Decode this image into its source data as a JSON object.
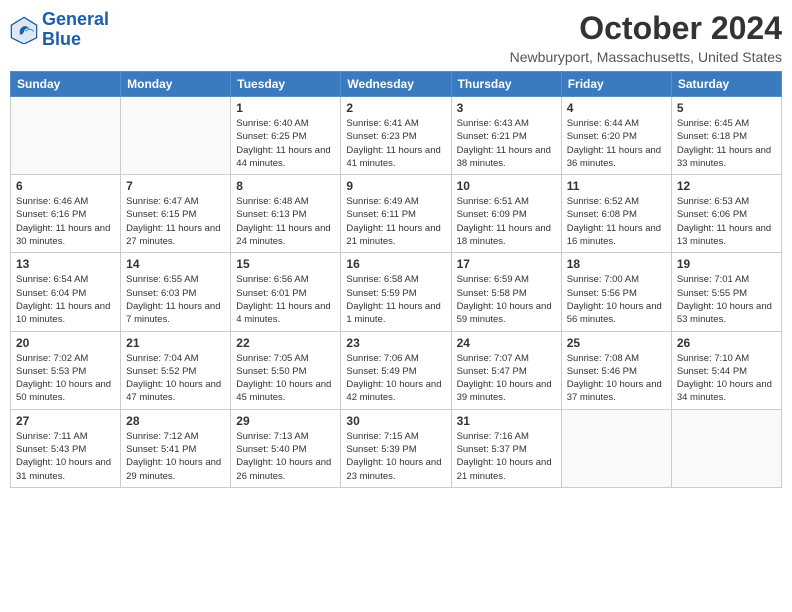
{
  "header": {
    "logo_line1": "General",
    "logo_line2": "Blue",
    "month": "October 2024",
    "location": "Newburyport, Massachusetts, United States"
  },
  "weekdays": [
    "Sunday",
    "Monday",
    "Tuesday",
    "Wednesday",
    "Thursday",
    "Friday",
    "Saturday"
  ],
  "weeks": [
    [
      {
        "day": "",
        "info": ""
      },
      {
        "day": "",
        "info": ""
      },
      {
        "day": "1",
        "info": "Sunrise: 6:40 AM\nSunset: 6:25 PM\nDaylight: 11 hours and 44 minutes."
      },
      {
        "day": "2",
        "info": "Sunrise: 6:41 AM\nSunset: 6:23 PM\nDaylight: 11 hours and 41 minutes."
      },
      {
        "day": "3",
        "info": "Sunrise: 6:43 AM\nSunset: 6:21 PM\nDaylight: 11 hours and 38 minutes."
      },
      {
        "day": "4",
        "info": "Sunrise: 6:44 AM\nSunset: 6:20 PM\nDaylight: 11 hours and 36 minutes."
      },
      {
        "day": "5",
        "info": "Sunrise: 6:45 AM\nSunset: 6:18 PM\nDaylight: 11 hours and 33 minutes."
      }
    ],
    [
      {
        "day": "6",
        "info": "Sunrise: 6:46 AM\nSunset: 6:16 PM\nDaylight: 11 hours and 30 minutes."
      },
      {
        "day": "7",
        "info": "Sunrise: 6:47 AM\nSunset: 6:15 PM\nDaylight: 11 hours and 27 minutes."
      },
      {
        "day": "8",
        "info": "Sunrise: 6:48 AM\nSunset: 6:13 PM\nDaylight: 11 hours and 24 minutes."
      },
      {
        "day": "9",
        "info": "Sunrise: 6:49 AM\nSunset: 6:11 PM\nDaylight: 11 hours and 21 minutes."
      },
      {
        "day": "10",
        "info": "Sunrise: 6:51 AM\nSunset: 6:09 PM\nDaylight: 11 hours and 18 minutes."
      },
      {
        "day": "11",
        "info": "Sunrise: 6:52 AM\nSunset: 6:08 PM\nDaylight: 11 hours and 16 minutes."
      },
      {
        "day": "12",
        "info": "Sunrise: 6:53 AM\nSunset: 6:06 PM\nDaylight: 11 hours and 13 minutes."
      }
    ],
    [
      {
        "day": "13",
        "info": "Sunrise: 6:54 AM\nSunset: 6:04 PM\nDaylight: 11 hours and 10 minutes."
      },
      {
        "day": "14",
        "info": "Sunrise: 6:55 AM\nSunset: 6:03 PM\nDaylight: 11 hours and 7 minutes."
      },
      {
        "day": "15",
        "info": "Sunrise: 6:56 AM\nSunset: 6:01 PM\nDaylight: 11 hours and 4 minutes."
      },
      {
        "day": "16",
        "info": "Sunrise: 6:58 AM\nSunset: 5:59 PM\nDaylight: 11 hours and 1 minute."
      },
      {
        "day": "17",
        "info": "Sunrise: 6:59 AM\nSunset: 5:58 PM\nDaylight: 10 hours and 59 minutes."
      },
      {
        "day": "18",
        "info": "Sunrise: 7:00 AM\nSunset: 5:56 PM\nDaylight: 10 hours and 56 minutes."
      },
      {
        "day": "19",
        "info": "Sunrise: 7:01 AM\nSunset: 5:55 PM\nDaylight: 10 hours and 53 minutes."
      }
    ],
    [
      {
        "day": "20",
        "info": "Sunrise: 7:02 AM\nSunset: 5:53 PM\nDaylight: 10 hours and 50 minutes."
      },
      {
        "day": "21",
        "info": "Sunrise: 7:04 AM\nSunset: 5:52 PM\nDaylight: 10 hours and 47 minutes."
      },
      {
        "day": "22",
        "info": "Sunrise: 7:05 AM\nSunset: 5:50 PM\nDaylight: 10 hours and 45 minutes."
      },
      {
        "day": "23",
        "info": "Sunrise: 7:06 AM\nSunset: 5:49 PM\nDaylight: 10 hours and 42 minutes."
      },
      {
        "day": "24",
        "info": "Sunrise: 7:07 AM\nSunset: 5:47 PM\nDaylight: 10 hours and 39 minutes."
      },
      {
        "day": "25",
        "info": "Sunrise: 7:08 AM\nSunset: 5:46 PM\nDaylight: 10 hours and 37 minutes."
      },
      {
        "day": "26",
        "info": "Sunrise: 7:10 AM\nSunset: 5:44 PM\nDaylight: 10 hours and 34 minutes."
      }
    ],
    [
      {
        "day": "27",
        "info": "Sunrise: 7:11 AM\nSunset: 5:43 PM\nDaylight: 10 hours and 31 minutes."
      },
      {
        "day": "28",
        "info": "Sunrise: 7:12 AM\nSunset: 5:41 PM\nDaylight: 10 hours and 29 minutes."
      },
      {
        "day": "29",
        "info": "Sunrise: 7:13 AM\nSunset: 5:40 PM\nDaylight: 10 hours and 26 minutes."
      },
      {
        "day": "30",
        "info": "Sunrise: 7:15 AM\nSunset: 5:39 PM\nDaylight: 10 hours and 23 minutes."
      },
      {
        "day": "31",
        "info": "Sunrise: 7:16 AM\nSunset: 5:37 PM\nDaylight: 10 hours and 21 minutes."
      },
      {
        "day": "",
        "info": ""
      },
      {
        "day": "",
        "info": ""
      }
    ]
  ]
}
